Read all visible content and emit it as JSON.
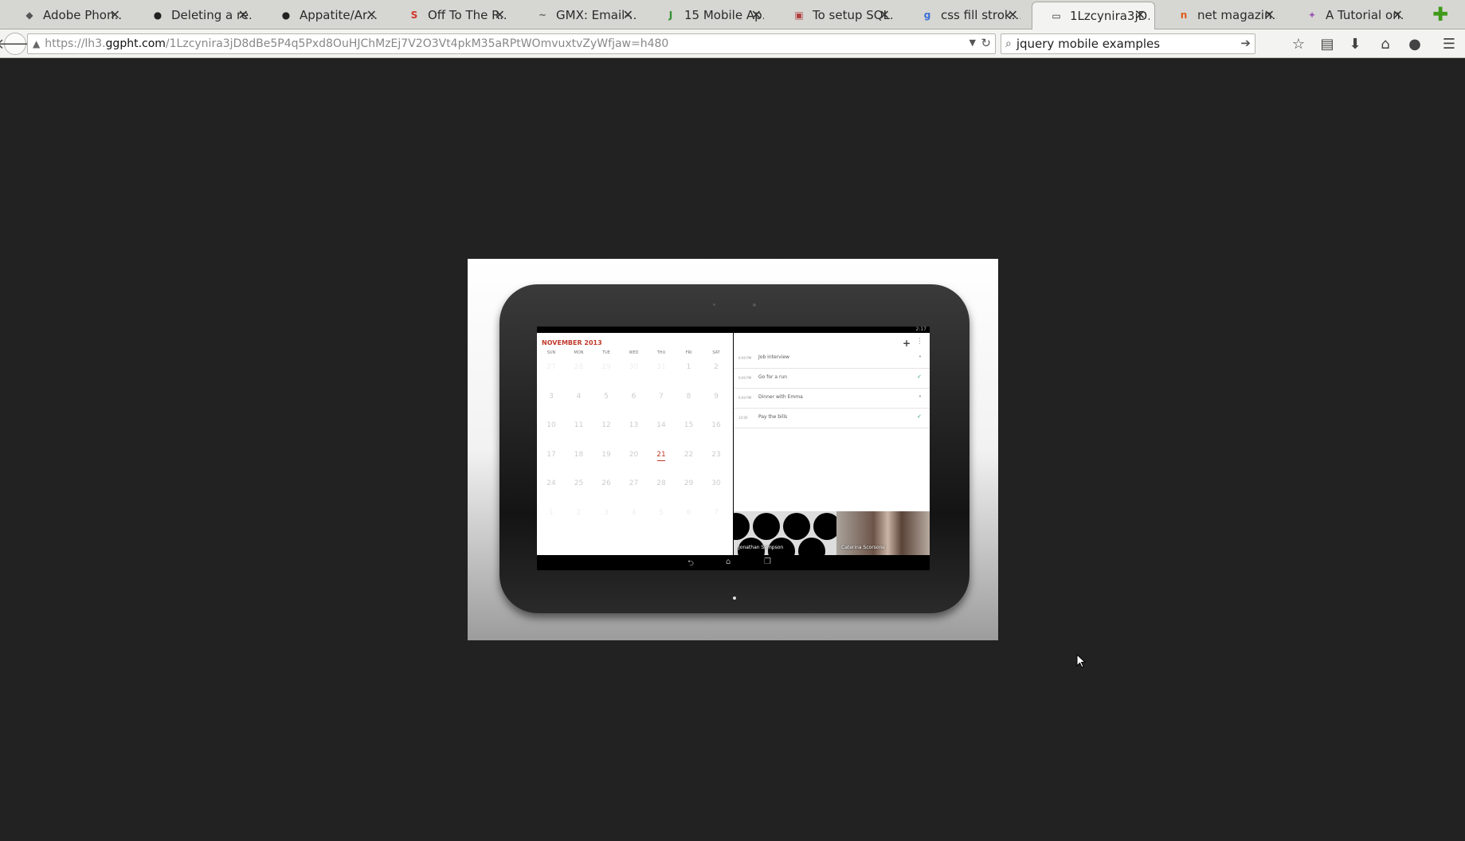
{
  "tabs": [
    {
      "title": "Adobe Phon...",
      "icon": "adobe-icon",
      "color": "#555555",
      "glyph": "◆"
    },
    {
      "title": "Deleting a re...",
      "icon": "github-icon",
      "color": "#222222",
      "glyph": "●"
    },
    {
      "title": "Appatite/Ar...",
      "icon": "github-icon",
      "color": "#222222",
      "glyph": "●"
    },
    {
      "title": "Off To The R...",
      "icon": "smashing-icon",
      "color": "#d0362b",
      "glyph": "S"
    },
    {
      "title": "GMX: Email-...",
      "icon": "gmx-icon",
      "color": "#666666",
      "glyph": "~"
    },
    {
      "title": "15 Mobile Ap...",
      "icon": "j-icon",
      "color": "#2f8f2f",
      "glyph": "J"
    },
    {
      "title": "To setup SQL...",
      "icon": "page-icon",
      "color": "#b04040",
      "glyph": "▣"
    },
    {
      "title": "css fill strok...",
      "icon": "google-icon",
      "color": "#3b6fd8",
      "glyph": "g"
    },
    {
      "title": "1Lzcynira3jD...",
      "icon": "document-icon",
      "color": "#333333",
      "glyph": "▭",
      "active": true
    },
    {
      "title": "net magazin...",
      "icon": "netmag-icon",
      "color": "#e05a1a",
      "glyph": "n"
    },
    {
      "title": "A Tutorial on...",
      "icon": "tutorial-icon",
      "color": "#9b59b6",
      "glyph": "✦"
    }
  ],
  "nav": {
    "url_prefix": "https://lh3.",
    "url_host": "ggpht.com",
    "url_path": "/1Lzcynira3jD8dBe5P4q5Pxd8OuHJChMzEj7V2O3Vt4pkM35aRPtWOmvuxtvZyWfjaw=h480",
    "search_value": "jquery mobile examples"
  },
  "calendar": {
    "month": "NOVEMBER 2013",
    "weekdays": [
      "SUN",
      "MON",
      "TUE",
      "WED",
      "THU",
      "FRI",
      "SAT"
    ],
    "weeks": [
      [
        "27",
        "28",
        "29",
        "30",
        "31",
        "1",
        "2"
      ],
      [
        "3",
        "4",
        "5",
        "6",
        "7",
        "8",
        "9"
      ],
      [
        "10",
        "11",
        "12",
        "13",
        "14",
        "15",
        "16"
      ],
      [
        "17",
        "18",
        "19",
        "20",
        "21",
        "22",
        "23"
      ],
      [
        "24",
        "25",
        "26",
        "27",
        "28",
        "29",
        "30"
      ],
      [
        "1",
        "2",
        "3",
        "4",
        "5",
        "6",
        "7"
      ]
    ],
    "today": "21",
    "accent": "#c0392b"
  },
  "agenda": [
    {
      "time": "6:00 PM",
      "title": "Job interview",
      "done": false
    },
    {
      "time": "6:00 PM",
      "title": "Go for a run",
      "done": true
    },
    {
      "time": "6:00 PM",
      "title": "Dinner with Emma",
      "done": false
    },
    {
      "time": "10:00",
      "title": "Pay the bills",
      "done": true
    }
  ],
  "contacts": [
    {
      "name": "Jonathan Sampson"
    },
    {
      "name": "Caterina Scorsone"
    }
  ],
  "status_time": "2:17"
}
